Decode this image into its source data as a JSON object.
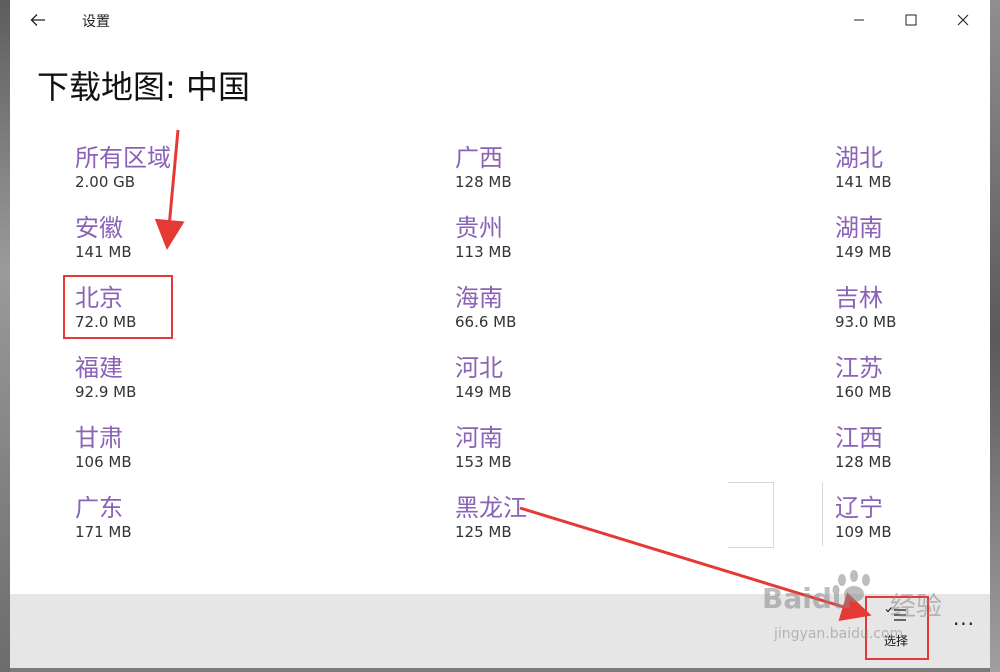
{
  "window": {
    "app_title": "设置",
    "back_icon": "back-arrow-icon",
    "minimize_icon": "minimize-icon",
    "maximize_icon": "maximize-icon",
    "close_icon": "close-icon"
  },
  "page": {
    "title": "下载地图: 中国"
  },
  "regions": [
    {
      "name": "所有区域",
      "size": "2.00 GB"
    },
    {
      "name": "安徽",
      "size": "141 MB"
    },
    {
      "name": "北京",
      "size": "72.0 MB"
    },
    {
      "name": "福建",
      "size": "92.9 MB"
    },
    {
      "name": "甘肃",
      "size": "106 MB"
    },
    {
      "name": "广东",
      "size": "171 MB"
    },
    {
      "name": "广西",
      "size": "128 MB"
    },
    {
      "name": "贵州",
      "size": "113 MB"
    },
    {
      "name": "海南",
      "size": "66.6 MB"
    },
    {
      "name": "河北",
      "size": "149 MB"
    },
    {
      "name": "河南",
      "size": "153 MB"
    },
    {
      "name": "黑龙江",
      "size": "125 MB"
    },
    {
      "name": "湖北",
      "size": "141 MB"
    },
    {
      "name": "湖南",
      "size": "149 MB"
    },
    {
      "name": "吉林",
      "size": "93.0 MB"
    },
    {
      "name": "江苏",
      "size": "160 MB"
    },
    {
      "name": "江西",
      "size": "128 MB"
    },
    {
      "name": "辽宁",
      "size": "109 MB"
    }
  ],
  "command_bar": {
    "select_label": "选择",
    "select_icon": "multi-select-list-icon",
    "more_label": "...",
    "more_icon": "more-ellipsis-icon"
  },
  "watermark": {
    "brand": "Baidu",
    "brand_cn": "经验",
    "url": "jingyan.baidu.com"
  },
  "colors": {
    "region_link": "#8a62b6",
    "annotation_red": "#e53935",
    "command_bar_bg": "#e6e6e6"
  }
}
